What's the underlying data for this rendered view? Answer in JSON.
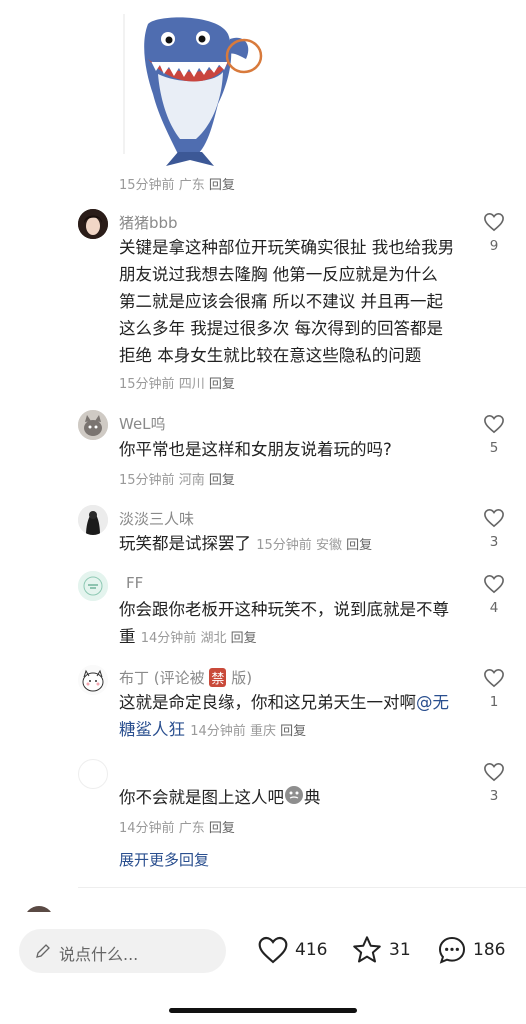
{
  "comments_prev": {
    "meta_time": "15分钟前",
    "meta_loc": "广东",
    "reply": "回复"
  },
  "comments": [
    {
      "user": "猪猪bbb",
      "text": "关键是拿这种部位开玩笑确实很扯 我也给我男朋友说过我想去隆胸 他第一反应就是为什么 第二就是应该会很痛 所以不建议 并且再一起这么多年 我提过很多次 每次得到的回答都是拒绝 本身女生就比较在意这些隐私的问题",
      "time": "15分钟前",
      "loc": "四川",
      "reply": "回复",
      "likes": "9"
    },
    {
      "user": "WeL呜",
      "text": "你平常也是这样和女朋友说着玩的吗?",
      "time": "15分钟前",
      "loc": "河南",
      "reply": "回复",
      "likes": "5"
    },
    {
      "user": "淡淡三人味",
      "text": "玩笑都是试探罢了",
      "time": "15分钟前",
      "loc": "安徽",
      "reply": "回复",
      "likes": "3"
    },
    {
      "user": "FF",
      "text": "你会跟你老板开这种玩笑不，说到底就是不尊重",
      "time": "14分钟前",
      "loc": "湖北",
      "reply": "回复",
      "likes": "4"
    },
    {
      "user_prefix": "布丁 (评论被",
      "user_badge": "禁",
      "user_suffix": "版)",
      "text": "这就是命定良缘，你和这兄弟天生一对啊",
      "mention": "@无糖鲨人狂",
      "time": "14分钟前",
      "loc": "重庆",
      "reply": "回复",
      "likes": "1"
    },
    {
      "user": "",
      "text_before": "你不会就是图上这人吧",
      "text_after": "典",
      "time": "14分钟前",
      "loc": "广东",
      "reply": "回复",
      "likes": "3"
    }
  ],
  "expand_more": "展开更多回复",
  "bottom": {
    "input_placeholder": "说点什么...",
    "likes": "416",
    "stars": "31",
    "comments": "186"
  },
  "colors": {
    "mention": "#2a4f8f",
    "muted": "#9a9a9a",
    "username": "#8a8a8a"
  }
}
